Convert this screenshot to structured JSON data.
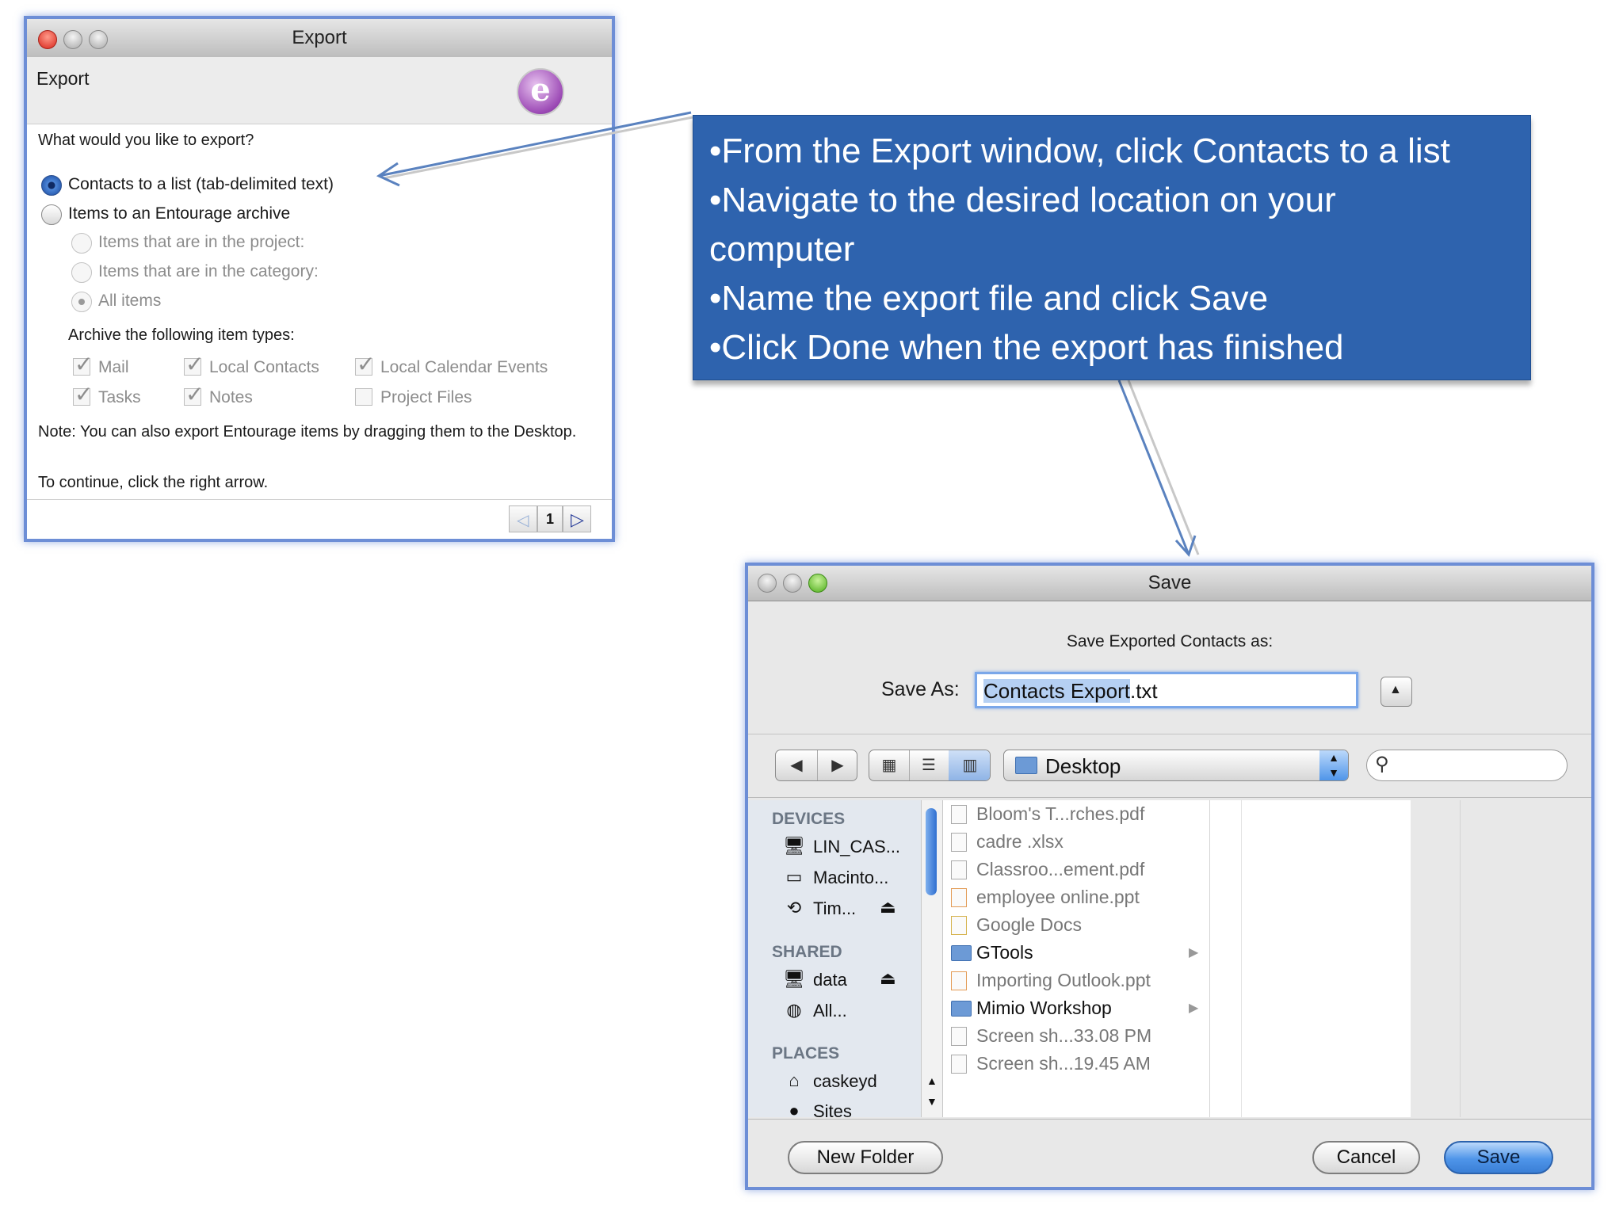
{
  "export_window": {
    "title": "Export",
    "header": "Export",
    "question": "What would you like to export?",
    "options": [
      {
        "label": "Contacts to a list (tab-delimited text)",
        "selected": true
      },
      {
        "label": "Items to an Entourage archive",
        "selected": false
      }
    ],
    "sub_options": [
      {
        "label": "Items that are in the project:"
      },
      {
        "label": "Items that are in the category:"
      },
      {
        "label": "All items"
      }
    ],
    "archive_heading": "Archive the following item types:",
    "item_types": [
      {
        "label": "Mail",
        "checked": true
      },
      {
        "label": "Local Contacts",
        "checked": true
      },
      {
        "label": "Local Calendar Events",
        "checked": true
      },
      {
        "label": "Tasks",
        "checked": true
      },
      {
        "label": "Notes",
        "checked": true
      },
      {
        "label": "Project Files",
        "checked": false
      }
    ],
    "note": "Note: You can also export Entourage items by dragging them to the Desktop.",
    "continue_text": "To continue, click the right arrow.",
    "page_number": "1"
  },
  "callout": {
    "lines": [
      "•From the Export window, click Contacts to a list",
      "•Navigate to the desired location on your",
      "computer",
      "•Name the export file and click Save",
      "•Click Done when the export has finished"
    ],
    "color": "#2e63ae"
  },
  "save_window": {
    "title": "Save",
    "prompt": "Save Exported Contacts as:",
    "save_as_label": "Save As:",
    "filename_selected": "Contacts Export",
    "filename_ext": ".txt",
    "location": "Desktop",
    "sidebar": {
      "devices_label": "DEVICES",
      "devices": [
        "LIN_CAS...",
        "Macinto...",
        "Tim..."
      ],
      "shared_label": "SHARED",
      "shared": [
        "data",
        "All..."
      ],
      "places_label": "PLACES",
      "places": [
        "caskeyd",
        "Sites"
      ]
    },
    "files": [
      {
        "name": "Bloom's T...rches.pdf",
        "folder": false
      },
      {
        "name": "cadre .xlsx",
        "folder": false
      },
      {
        "name": "Classroo...ement.pdf",
        "folder": false
      },
      {
        "name": "employee online.ppt",
        "folder": false
      },
      {
        "name": "Google Docs",
        "folder": false
      },
      {
        "name": "GTools",
        "folder": true
      },
      {
        "name": "Importing Outlook.ppt",
        "folder": false
      },
      {
        "name": "Mimio Workshop",
        "folder": true
      },
      {
        "name": "Screen sh...33.08 PM",
        "folder": false
      },
      {
        "name": "Screen sh...19.45 AM",
        "folder": false
      }
    ],
    "buttons": {
      "new_folder": "New Folder",
      "cancel": "Cancel",
      "save": "Save"
    }
  }
}
